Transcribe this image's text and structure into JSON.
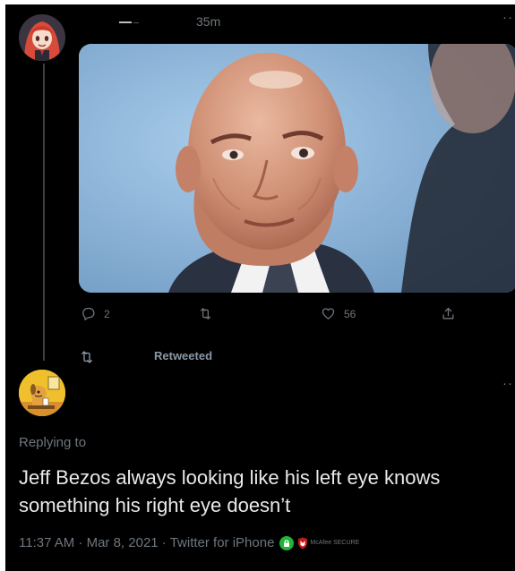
{
  "colors": {
    "background": "#000000",
    "text_primary": "#e7e9ea",
    "text_secondary": "#71767b",
    "thread_line": "#3b3f43",
    "secure_badge": "#1fb53b",
    "mcafee_red": "#c01818"
  },
  "tweet": {
    "timestamp": "35m",
    "more_label": "··",
    "actions": {
      "reply_count": "2",
      "like_count": "56"
    },
    "retweeted_label": "Retweeted"
  },
  "reply": {
    "more_label": "··",
    "replying_to": "Replying to",
    "text": "Jeff Bezos always looking like his left eye knows something his right eye doesn’t",
    "meta": "11:37 AM · Mar 8, 2021 · Twitter for iPhone",
    "badge_label": "McAfee SECURE"
  },
  "icons": [
    "reply-icon",
    "retweet-icon",
    "like-icon",
    "share-icon",
    "lock-icon",
    "mcafee-shield-icon"
  ]
}
